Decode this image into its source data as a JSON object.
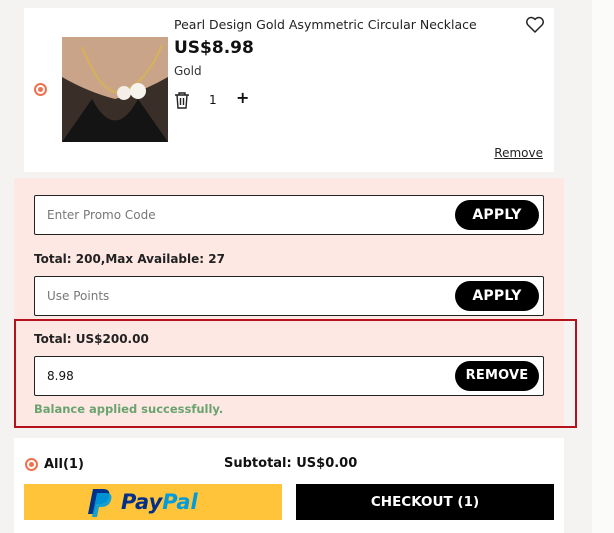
{
  "product": {
    "title": "Pearl Design Gold Asymmetric Circular Necklace",
    "price": "US$8.98",
    "variant": "Gold",
    "quantity": "1",
    "quantity_plus": "+",
    "remove_label": "Remove",
    "icons": {
      "wishlist": "heart-icon",
      "delete": "trash-icon"
    }
  },
  "promo": {
    "promo_placeholder": "Enter Promo Code",
    "apply_label": "APPLY",
    "points_info": "Total: 200,Max Available: 27",
    "points_placeholder": "Use Points",
    "points_apply_label": "APPLY",
    "balance_total": "Total: US$200.00",
    "balance_value": "8.98",
    "balance_remove_label": "REMOVE",
    "success_message": "Balance applied successfully."
  },
  "checkout": {
    "select_all_label": "All(1)",
    "subtotal": "Subtotal: US$0.00",
    "paypal_label": "PayPal",
    "checkout_label": "CHECKOUT (1)"
  },
  "colors": {
    "accent": "#f0714f",
    "panel_bg": "#fde8e4",
    "highlight_border": "#b5121b",
    "success": "#6aa36f",
    "paypal_yellow": "#ffc439",
    "paypal_dark_blue": "#003087",
    "paypal_light_blue": "#009cde"
  }
}
